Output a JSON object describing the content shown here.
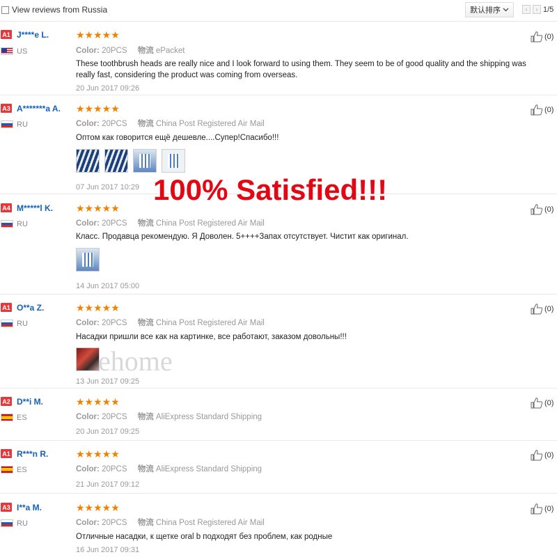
{
  "filter": {
    "label": "View reviews from Russia"
  },
  "sort": {
    "label": "默认排序"
  },
  "pagination": {
    "prev": "‹",
    "next": "›",
    "text": "1/5"
  },
  "overlay_text": "100% Satisfied!!!",
  "watermark": "ehome",
  "reviews": [
    {
      "badge": "A1",
      "name": "J****e L.",
      "country": "US",
      "flag": "us",
      "stars": "★★★★★",
      "color_label": "Color:",
      "color": "20PCS",
      "ship_label": "物流",
      "shipping": "ePacket",
      "text": "These toothbrush heads are really nice and I look forward to using them. They seem to be of good quality and the shipping was really fast, considering the product was coming from overseas.",
      "date": "20 Jun 2017 09:26",
      "likes": "(0)"
    },
    {
      "badge": "A3",
      "name": "A*******a A.",
      "country": "RU",
      "flag": "ru",
      "stars": "★★★★★",
      "color_label": "Color:",
      "color": "20PCS",
      "ship_label": "物流",
      "shipping": "China Post Registered Air Mail",
      "text": "Оптом как говорится ещё дешевле....Супер!Спасибо!!!",
      "date": "07 Jun 2017 10:29",
      "likes": "(0)"
    },
    {
      "badge": "A4",
      "name": "M*****l K.",
      "country": "RU",
      "flag": "ru",
      "stars": "★★★★★",
      "color_label": "Color:",
      "color": "20PCS",
      "ship_label": "物流",
      "shipping": "China Post Registered Air Mail",
      "text": "Класс. Продавца рекомендую. Я Доволен. 5++++Запах отсутствует. Чистит как оригинал.",
      "date": "14 Jun 2017 05:00",
      "likes": "(0)"
    },
    {
      "badge": "A1",
      "name": "O**a Z.",
      "country": "RU",
      "flag": "ru",
      "stars": "★★★★★",
      "color_label": "Color:",
      "color": "20PCS",
      "ship_label": "物流",
      "shipping": "China Post Registered Air Mail",
      "text": "Насадки пришли все как на картинке, все работают, заказом довольны!!!",
      "date": "13 Jun 2017 09:25",
      "likes": "(0)"
    },
    {
      "badge": "A2",
      "name": "D**i M.",
      "country": "ES",
      "flag": "es",
      "stars": "★★★★★",
      "color_label": "Color:",
      "color": "20PCS",
      "ship_label": "物流",
      "shipping": "AliExpress Standard Shipping",
      "text": "",
      "date": "20 Jun 2017 09:25",
      "likes": "(0)"
    },
    {
      "badge": "A1",
      "name": "R***n R.",
      "country": "ES",
      "flag": "es",
      "stars": "★★★★★",
      "color_label": "Color:",
      "color": "20PCS",
      "ship_label": "物流",
      "shipping": "AliExpress Standard Shipping",
      "text": "",
      "date": "21 Jun 2017 09:12",
      "likes": "(0)"
    },
    {
      "badge": "A3",
      "name": "I**a M.",
      "country": "RU",
      "flag": "ru",
      "stars": "★★★★★",
      "color_label": "Color:",
      "color": "20PCS",
      "ship_label": "物流",
      "shipping": "China Post Registered Air Mail",
      "text": "Отличные насадки, к щетке oral b подходят без проблем, как родные",
      "date": "16 Jun 2017 09:31",
      "likes": "(0)"
    }
  ]
}
